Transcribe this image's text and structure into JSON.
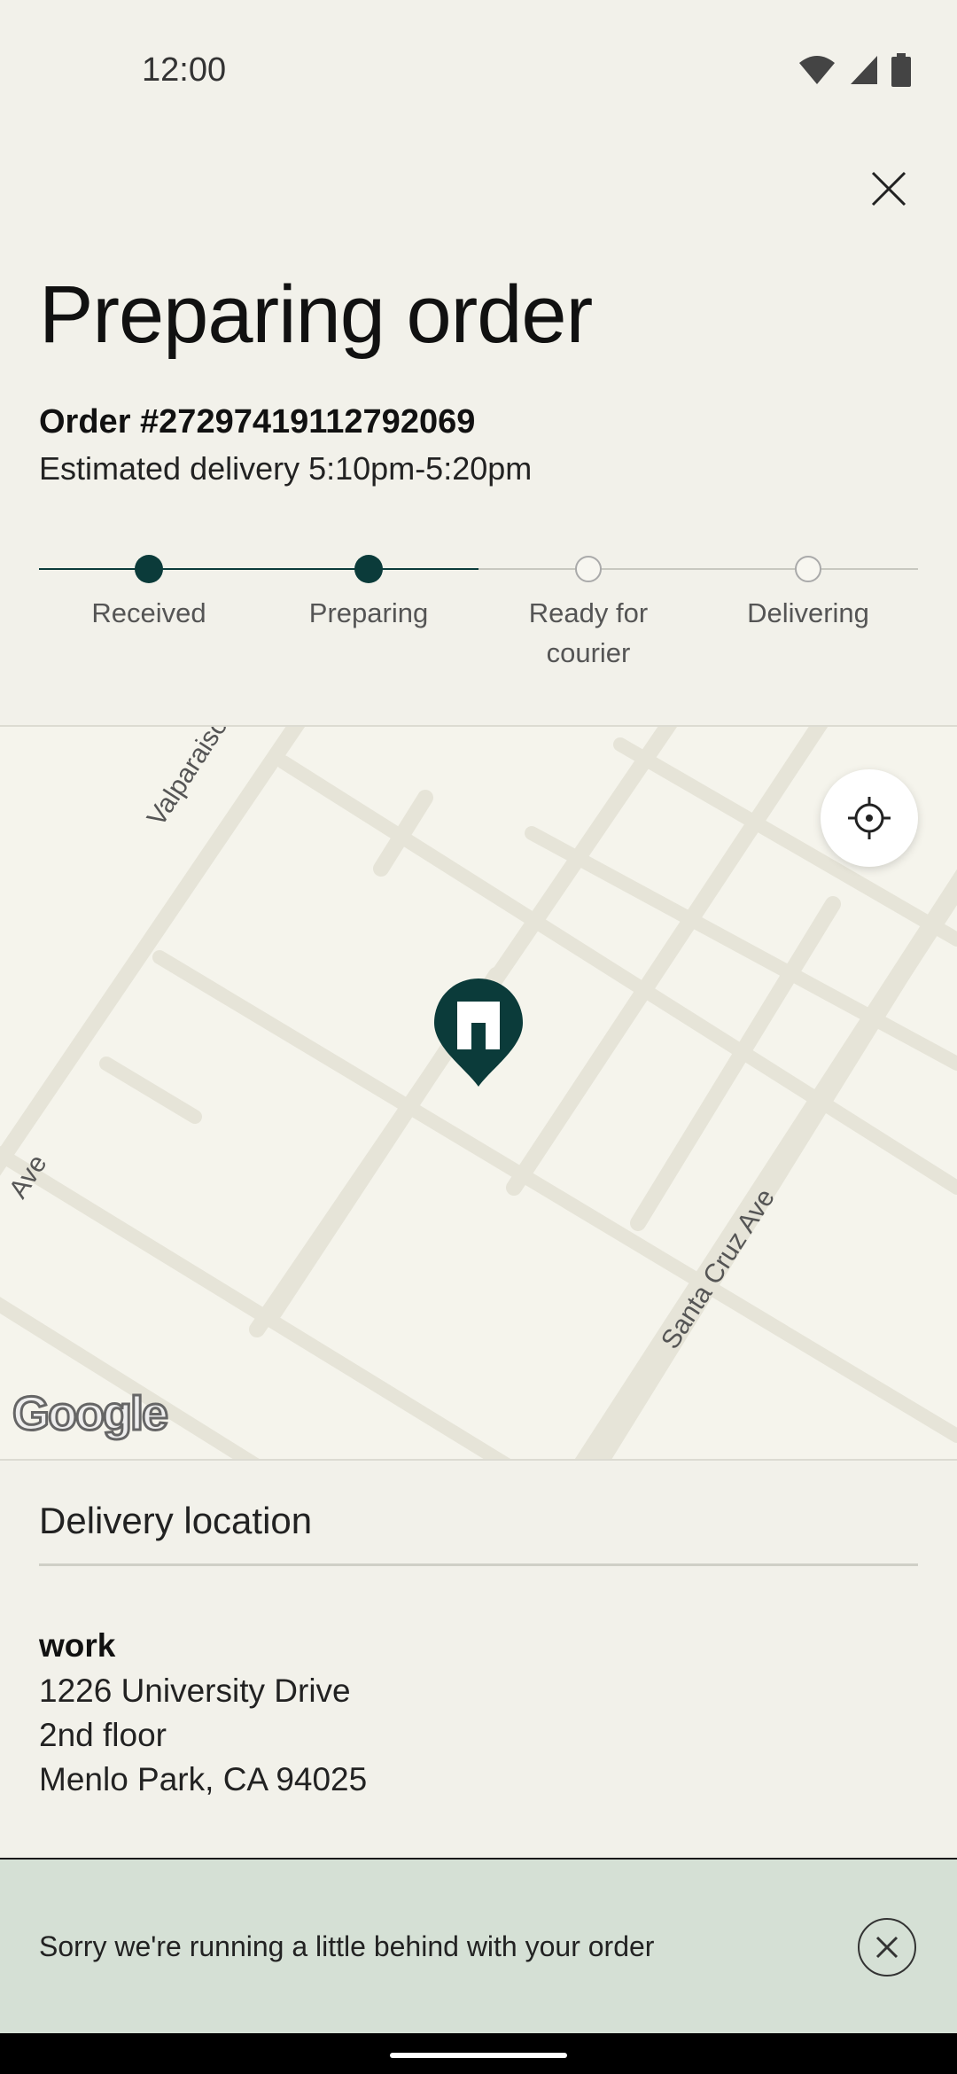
{
  "status_bar": {
    "time": "12:00",
    "icons": [
      "wifi-icon",
      "signal-icon",
      "battery-icon"
    ]
  },
  "header": {
    "close_icon": "close-icon",
    "title": "Preparing order"
  },
  "order": {
    "number": "Order #27297419112792069",
    "estimated": "Estimated delivery 5:10pm-5:20pm"
  },
  "progress": {
    "steps": [
      {
        "label": "Received",
        "done": true
      },
      {
        "label": "Preparing",
        "done": true
      },
      {
        "label": "Ready for courier",
        "done": false
      },
      {
        "label": "Delivering",
        "done": false
      }
    ],
    "current_step": 2,
    "accent_color": "#0b3b3a"
  },
  "map": {
    "streets": [
      "Valparaiso Ave",
      "Santa Cruz Ave",
      "Ave"
    ],
    "attribution": "Google",
    "locate_icon": "crosshair-icon",
    "pin_icon": "store-pin-icon"
  },
  "delivery": {
    "section_title": "Delivery location",
    "name": "work",
    "line1": "1226 University Drive",
    "line2": "2nd floor",
    "line3": "Menlo Park, CA 94025"
  },
  "toast": {
    "message": "Sorry we're running a little behind with your order",
    "close_icon": "close-circle-icon"
  }
}
